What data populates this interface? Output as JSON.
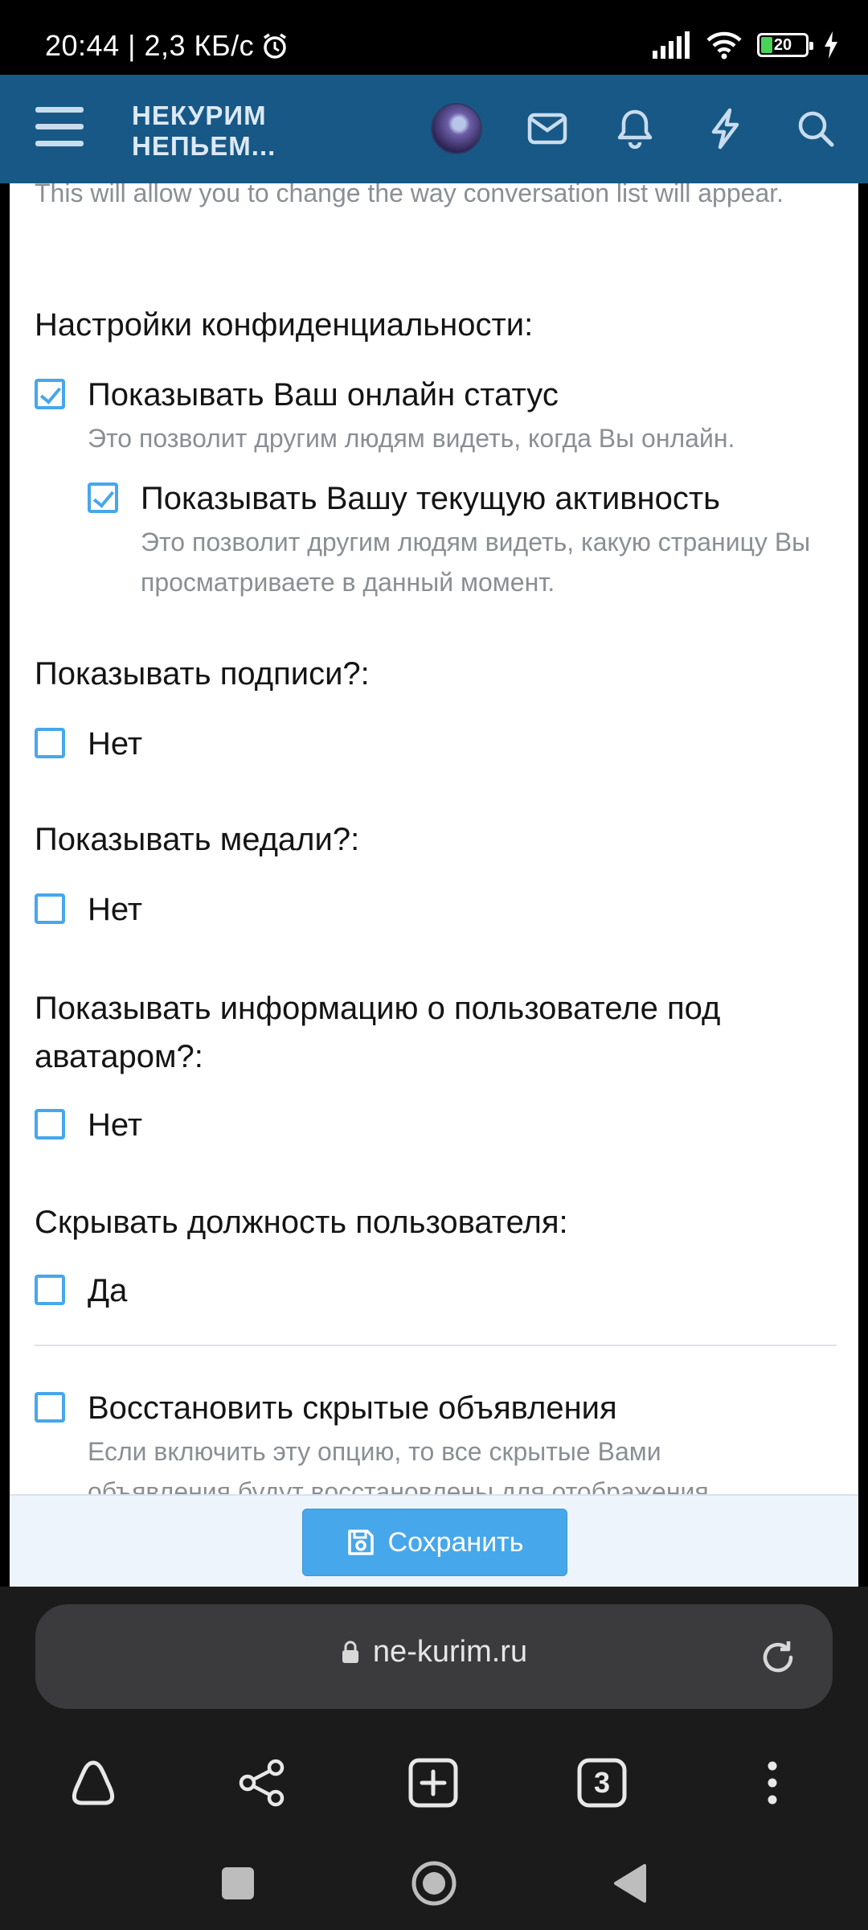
{
  "status_bar": {
    "time_and_speed": "20:44 | 2,3 КБ/с",
    "battery": "20"
  },
  "header": {
    "logo_line1": "НЕКУРИМ",
    "logo_line2": "НЕПЬЕМ..."
  },
  "content": {
    "intro": "This will allow you to change the way conversation list will appear.",
    "privacy": {
      "title": "Настройки конфиденциальности:",
      "online_label": "Показывать Ваш онлайн статус",
      "online_hint": "Это позволит другим людям видеть, когда Вы онлайн.",
      "activity_label": "Показывать Вашу текущую активность",
      "activity_hint": "Это позволит другим людям видеть, какую страницу Вы просматриваете в данный момент."
    },
    "signatures": {
      "title": "Показывать подписи?:",
      "option": "Нет"
    },
    "medals": {
      "title": "Показывать медали?:",
      "option": "Нет"
    },
    "userinfo": {
      "title": "Показывать информацию о пользователе под аватаром?:",
      "option": "Нет"
    },
    "usertitle": {
      "title": "Скрывать должность пользователя:",
      "option": "Да"
    },
    "restore": {
      "label": "Восстановить скрытые объявления",
      "hint": "Если включить эту опцию, то все скрытые Вами объявления будут восстановлены для отображения."
    }
  },
  "save_button": "Сохранить",
  "browser": {
    "url": "ne-kurim.ru",
    "tabs_count": "3"
  },
  "colors": {
    "header_bg": "#185886",
    "accent": "#47a7eb"
  }
}
